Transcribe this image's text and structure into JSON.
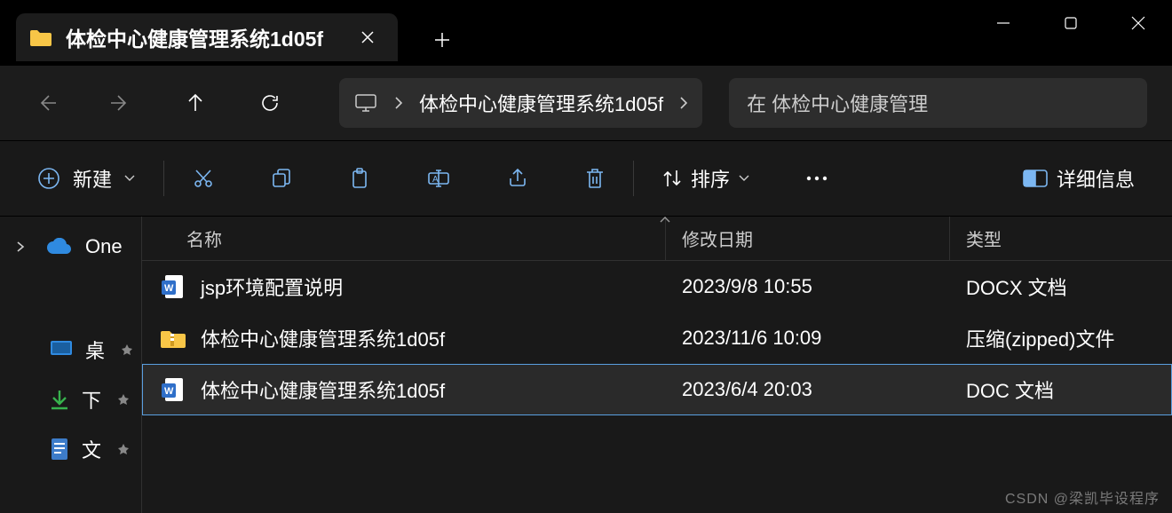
{
  "titlebar": {
    "tab_title": "体检中心健康管理系统1d05f"
  },
  "breadcrumb": {
    "items": [
      "体检中心健康管理系统1d05f"
    ]
  },
  "search": {
    "placeholder": "在 体检中心健康管理"
  },
  "toolbar": {
    "new_label": "新建",
    "sort_label": "排序",
    "view_label": "详细信息"
  },
  "sidebar": {
    "items": [
      {
        "label": "One",
        "icon": "cloud-icon",
        "expandable": true
      },
      {
        "label": "桌",
        "icon": "desktop-icon",
        "pinned": true
      },
      {
        "label": "下",
        "icon": "download-icon",
        "pinned": true
      },
      {
        "label": "文",
        "icon": "document-icon",
        "pinned": true
      }
    ]
  },
  "columns": {
    "name": "名称",
    "date": "修改日期",
    "type": "类型"
  },
  "files": [
    {
      "icon": "docx-icon",
      "name": "jsp环境配置说明",
      "date": "2023/9/8 10:55",
      "type": "DOCX 文档",
      "selected": false
    },
    {
      "icon": "zip-icon",
      "name": "体检中心健康管理系统1d05f",
      "date": "2023/11/6 10:09",
      "type": "压缩(zipped)文件",
      "selected": false
    },
    {
      "icon": "doc-icon",
      "name": "体检中心健康管理系统1d05f",
      "date": "2023/6/4 20:03",
      "type": "DOC 文档",
      "selected": true
    }
  ],
  "watermark": "CSDN @梁凯毕设程序"
}
